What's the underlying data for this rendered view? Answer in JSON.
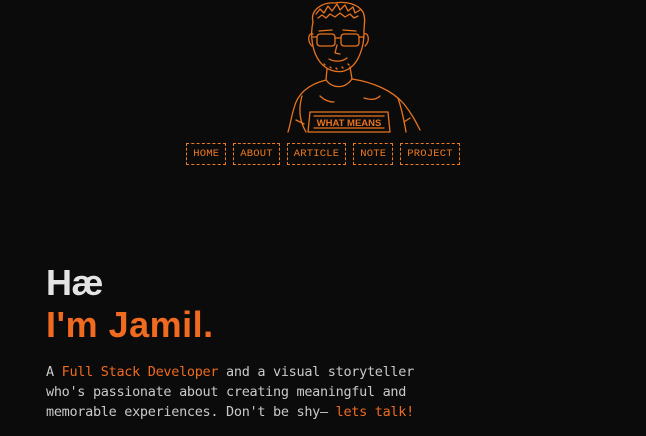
{
  "colors": {
    "background": "#0b0b0b",
    "accent": "#f06a1f",
    "text": "#c9c9c9",
    "heading": "#e4e4e4"
  },
  "avatar": {
    "icon": "line-art-portrait",
    "shirt_text": "WHAT MEANS"
  },
  "nav": {
    "items": [
      {
        "label": "HOME"
      },
      {
        "label": "ABOUT"
      },
      {
        "label": "ARTICLE"
      },
      {
        "label": "NOTE"
      },
      {
        "label": "PROJECT"
      }
    ]
  },
  "hero": {
    "greeting": "Hæ",
    "name": "I'm Jamil.",
    "intro_prefix": "A ",
    "role": "Full Stack Developer",
    "intro_middle": " and a visual storyteller who's passionate about creating meaningful and memorable experiences. Don't be shy— ",
    "cta": "lets talk!"
  }
}
